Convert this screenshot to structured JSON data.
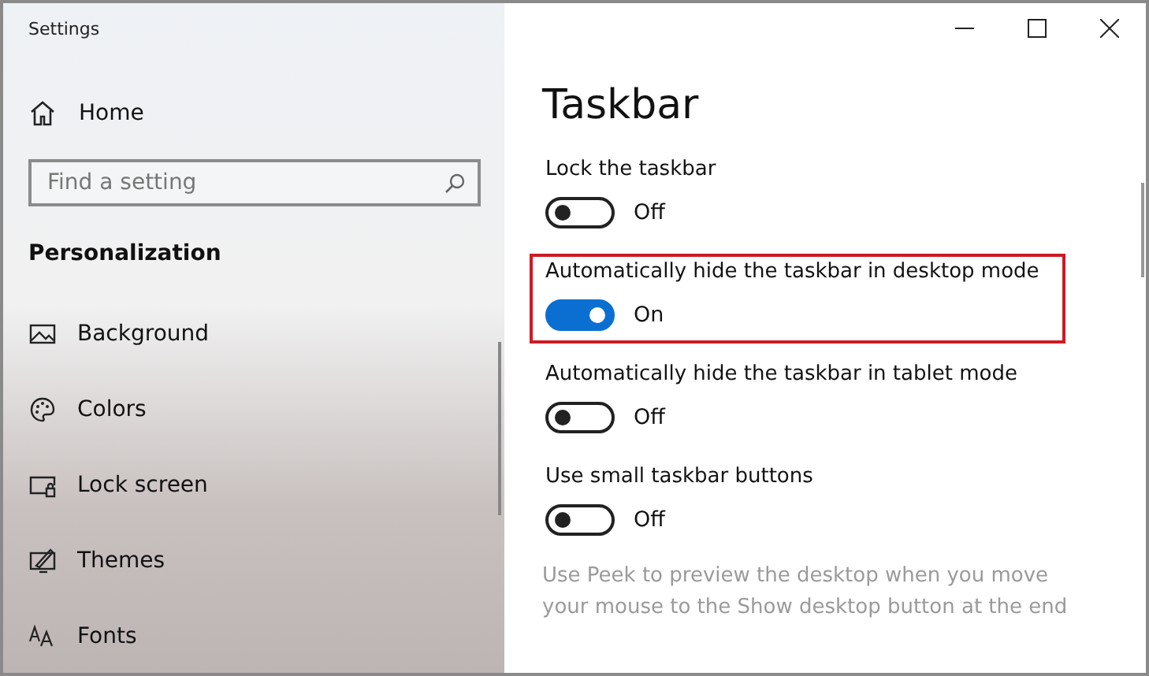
{
  "window": {
    "title": "Settings"
  },
  "sidebar": {
    "home": "Home",
    "search": {
      "placeholder": "Find a setting"
    },
    "section": "Personalization",
    "items": [
      {
        "label": "Background"
      },
      {
        "label": "Colors"
      },
      {
        "label": "Lock screen"
      },
      {
        "label": "Themes"
      },
      {
        "label": "Fonts"
      }
    ]
  },
  "page": {
    "title": "Taskbar",
    "settings": [
      {
        "label": "Lock the taskbar",
        "on": false,
        "state": "Off",
        "highlighted": false
      },
      {
        "label": "Automatically hide the taskbar in desktop mode",
        "on": true,
        "state": "On",
        "highlighted": true
      },
      {
        "label": "Automatically hide the taskbar in tablet mode",
        "on": false,
        "state": "Off",
        "highlighted": false
      },
      {
        "label": "Use small taskbar buttons",
        "on": false,
        "state": "Off",
        "highlighted": false
      }
    ],
    "description": "Use Peek to preview the desktop when you move your mouse to the Show desktop button at the end"
  }
}
